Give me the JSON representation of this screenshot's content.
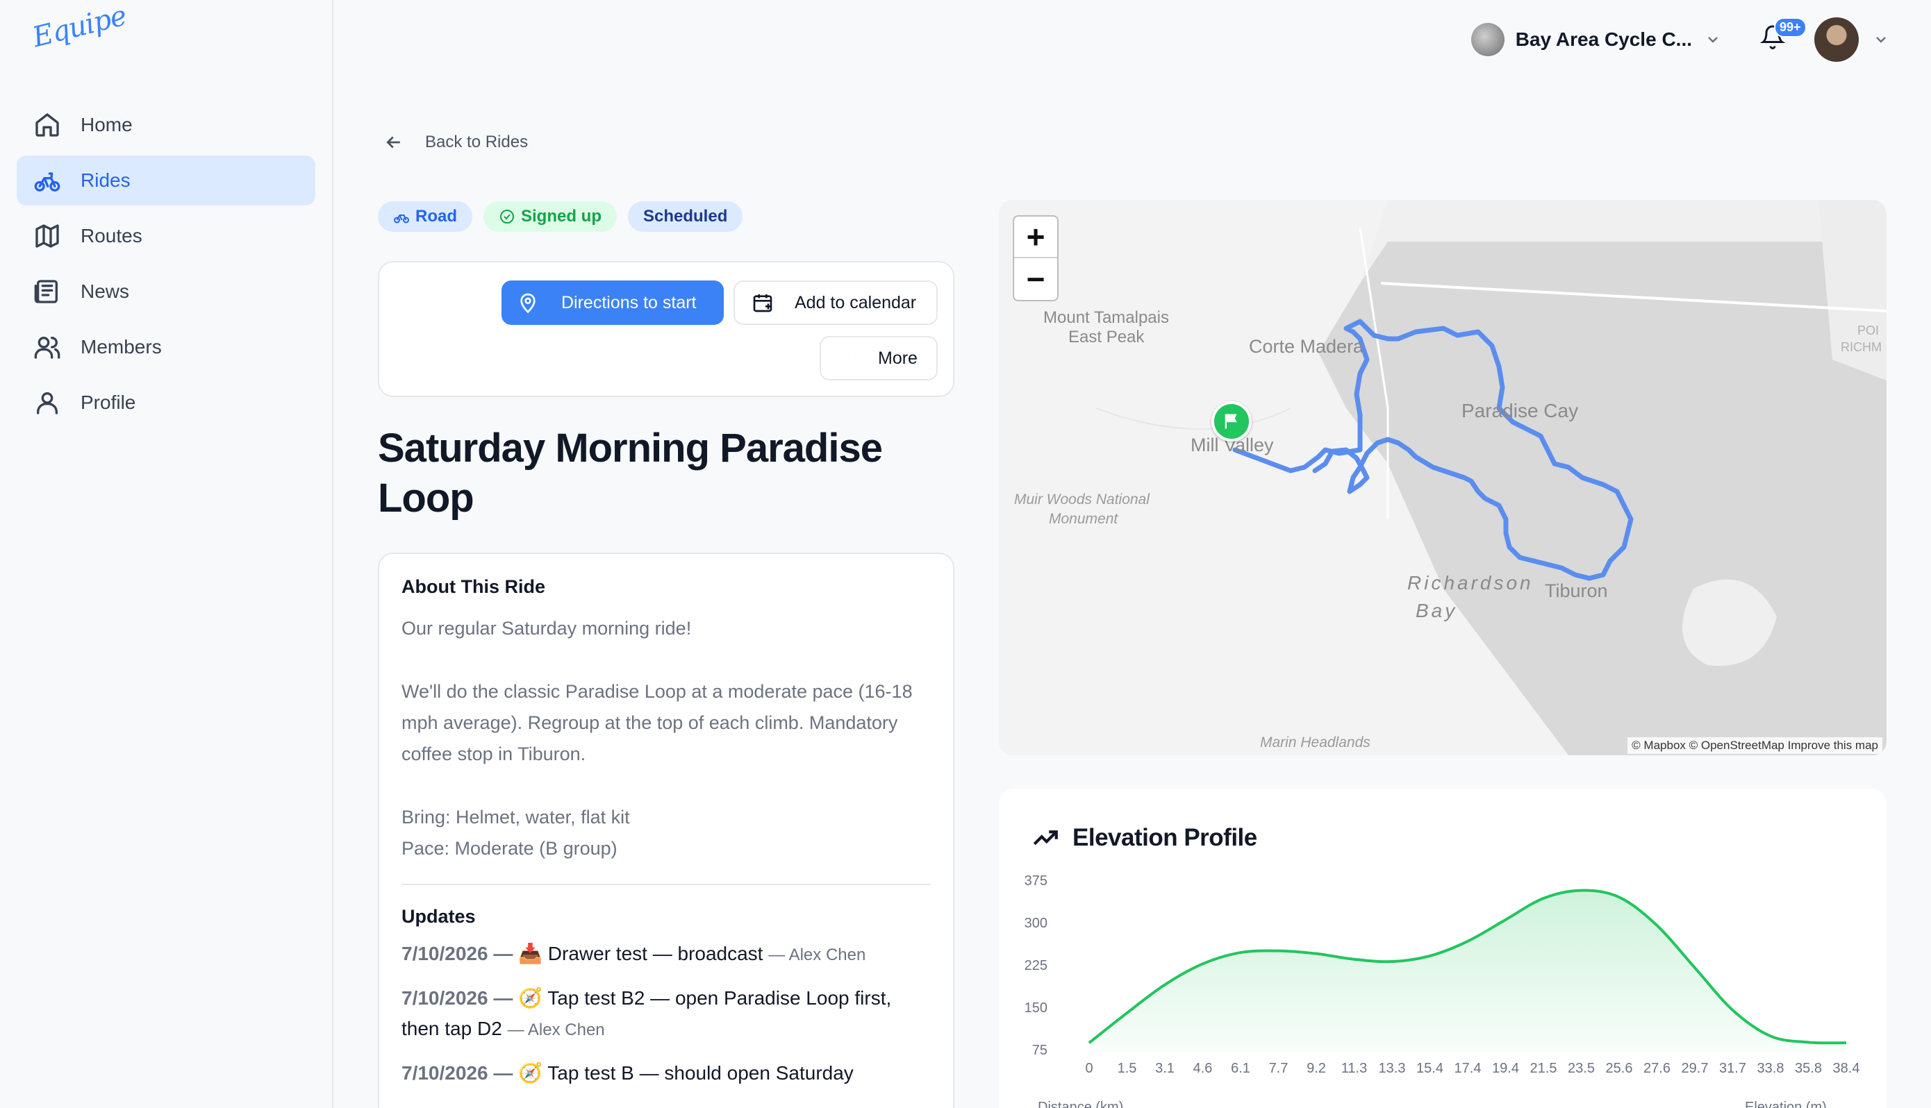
{
  "app": {
    "logo": "Equipe"
  },
  "sidebar": {
    "items": [
      {
        "label": "Home",
        "icon": "home-icon"
      },
      {
        "label": "Rides",
        "icon": "bike-icon",
        "active": true
      },
      {
        "label": "Routes",
        "icon": "map-icon"
      },
      {
        "label": "News",
        "icon": "newspaper-icon"
      },
      {
        "label": "Members",
        "icon": "users-icon"
      },
      {
        "label": "Profile",
        "icon": "user-icon"
      }
    ]
  },
  "topbar": {
    "club_name": "Bay Area Cycle C...",
    "notifications_badge": "99+"
  },
  "back_link": "Back to Rides",
  "tags": {
    "road": "Road",
    "signed_up": "Signed up",
    "scheduled": "Scheduled"
  },
  "actions": {
    "directions": "Directions to start",
    "calendar": "Add to calendar",
    "more": "More"
  },
  "ride": {
    "title": "Saturday Morning Paradise Loop",
    "about_heading": "About This Ride",
    "about_p1": "Our regular Saturday morning ride!",
    "about_p2": "We'll do the classic Paradise Loop at a moderate pace (16-18 mph average). Regroup at the top of each climb. Mandatory coffee stop in Tiburon.",
    "about_p3a": "Bring: Helmet, water, flat kit",
    "about_p3b": "Pace: Moderate (B group)",
    "updates_heading": "Updates",
    "updates": [
      {
        "date": "7/10/2026",
        "emoji": "📥",
        "text": "Drawer test — broadcast",
        "author": "Alex Chen"
      },
      {
        "date": "7/10/2026",
        "emoji": "🧭",
        "text": "Tap test B2 — open Paradise Loop first, then tap D2",
        "author": "Alex Chen"
      },
      {
        "date": "7/10/2026",
        "emoji": "🧭",
        "text": "Tap test B — should open Saturday",
        "author": ""
      }
    ]
  },
  "map": {
    "labels": {
      "tamalpais": "Mount Tamalpais",
      "east_peak": "East Peak",
      "corte_madera": "Corte Madera",
      "mill_valley": "Mill Valley",
      "paradise_cay": "Paradise Cay",
      "muir1": "Muir Woods National",
      "muir2": "Monument",
      "richardson1": "Richardson",
      "richardson2": "Bay",
      "tiburon": "Tiburon",
      "marin": "Marin Headlands",
      "point1": "POI",
      "point2": "RICHM"
    },
    "zoom_in": "+",
    "zoom_out": "−",
    "attribution": "© Mapbox © OpenStreetMap Improve this map",
    "route_color": "#5b8def"
  },
  "elevation": {
    "title": "Elevation Profile",
    "xlabel": "Distance (km)",
    "ylabel": "Elevation (m)"
  },
  "chart_data": {
    "type": "area",
    "title": "Elevation Profile",
    "xlabel": "Distance (km)",
    "ylabel": "Elevation (m)",
    "x": [
      0,
      1.5,
      3.1,
      4.6,
      6.1,
      7.7,
      9.2,
      11.3,
      13.3,
      15.4,
      17.4,
      19.4,
      21.5,
      23.5,
      25.6,
      27.6,
      29.7,
      31.7,
      33.8,
      35.8,
      38.4
    ],
    "y": [
      92,
      145,
      195,
      232,
      252,
      255,
      250,
      240,
      236,
      246,
      272,
      310,
      348,
      362,
      350,
      300,
      225,
      150,
      104,
      93,
      92
    ],
    "yticks": [
      75,
      150,
      225,
      300,
      375
    ],
    "ylim": [
      75,
      375
    ],
    "color": "#22c55e"
  }
}
